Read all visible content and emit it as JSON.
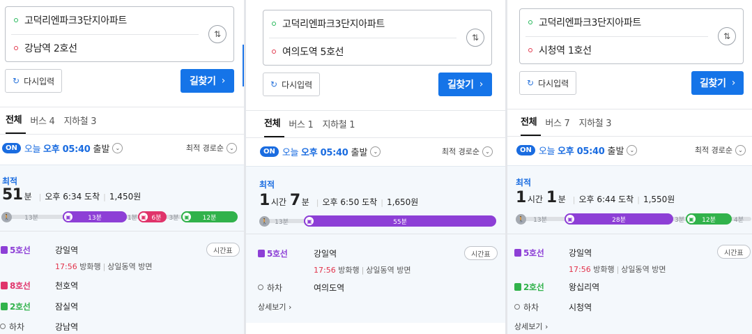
{
  "colors": {
    "line5": "#8d3fd6",
    "line8": "#e0346b",
    "line2": "#31b24b",
    "accent": "#1a73e8"
  },
  "panels": [
    {
      "origin": "고덕리엔파크3단지아파트",
      "destination": "강남역 2호선",
      "reset_label": "다시입력",
      "search_label": "길찾기",
      "tabs": [
        "전체",
        "버스 4",
        "지하철 3"
      ],
      "on_badge": "ON",
      "depart_prefix": "오늘",
      "depart_time": "오후 05:40",
      "depart_suffix": "출발",
      "sort_label": "최적 경로순",
      "best_label": "최적",
      "dur_num1": "51",
      "dur_unit1": "분",
      "arrival": "오후 6:34 도착",
      "fare": "1,450원",
      "bar": {
        "walk1": "13분",
        "seg1": "13분",
        "gap1": "1분",
        "seg2": "6분",
        "gap2": "3분",
        "seg3": "12분"
      },
      "steps": [
        {
          "line": "5호선",
          "station": "강일역"
        },
        {
          "line": "8호선",
          "station": "천호역"
        },
        {
          "line": "2호선",
          "station": "잠실역"
        },
        {
          "line": "하차",
          "station": "강남역"
        }
      ],
      "sub": {
        "time": "17:56",
        "dir": "방화행",
        "via": "상일동역 방면"
      },
      "timetable_label": "시간표"
    },
    {
      "origin": "고덕리엔파크3단지아파트",
      "destination": "여의도역 5호선",
      "reset_label": "다시입력",
      "search_label": "길찾기",
      "tabs": [
        "전체",
        "버스 1",
        "지하철 1"
      ],
      "on_badge": "ON",
      "depart_prefix": "오늘",
      "depart_time": "오후 05:40",
      "depart_suffix": "출발",
      "sort_label": "최적 경로순",
      "best_label": "최적",
      "dur_num1": "1",
      "dur_unit1": "시간",
      "dur_num2": "7",
      "dur_unit2": "분",
      "arrival": "오후 6:50 도착",
      "fare": "1,650원",
      "bar": {
        "walk1": "13분",
        "seg1": "55분"
      },
      "steps": [
        {
          "line": "5호선",
          "station": "강일역"
        },
        {
          "line": "하차",
          "station": "여의도역"
        }
      ],
      "sub": {
        "time": "17:56",
        "dir": "방화행",
        "via": "상일동역 방면"
      },
      "timetable_label": "시간표",
      "detail_label": "상세보기"
    },
    {
      "origin": "고덕리엔파크3단지아파트",
      "destination": "시청역 1호선",
      "reset_label": "다시입력",
      "search_label": "길찾기",
      "tabs": [
        "전체",
        "버스 7",
        "지하철 3"
      ],
      "on_badge": "ON",
      "depart_prefix": "오늘",
      "depart_time": "오후 05:40",
      "depart_suffix": "출발",
      "sort_label": "최적 경로순",
      "best_label": "최적",
      "dur_num1": "1",
      "dur_unit1": "시간",
      "dur_num2": "1",
      "dur_unit2": "분",
      "arrival": "오후 6:44 도착",
      "fare": "1,550원",
      "bar": {
        "walk1": "13분",
        "seg1": "28분",
        "gap1": "3분",
        "seg2": "12분",
        "gap2": "4분"
      },
      "steps": [
        {
          "line": "5호선",
          "station": "강일역"
        },
        {
          "line": "2호선",
          "station": "왕십리역"
        },
        {
          "line": "하차",
          "station": "시청역"
        }
      ],
      "sub": {
        "time": "17:56",
        "dir": "방화행",
        "via": "상일동역 방면"
      },
      "timetable_label": "시간표",
      "detail_label": "상세보기"
    }
  ]
}
